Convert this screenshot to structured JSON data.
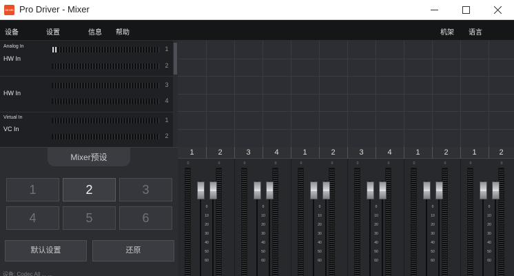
{
  "window": {
    "title": "Pro Driver - Mixer",
    "logo_text": "BEHRI"
  },
  "menu": {
    "left": [
      "设备",
      "设置",
      "信息",
      "帮助"
    ],
    "right": [
      "机架",
      "语言"
    ]
  },
  "inputs": {
    "groups": [
      {
        "small": "Analog In",
        "name": "HW In",
        "channels": [
          "1",
          "2"
        ]
      },
      {
        "small": "",
        "name": "HW In",
        "channels": [
          "3",
          "4"
        ]
      },
      {
        "small": "Virtual In",
        "name": "VC In",
        "channels": [
          "1",
          "2"
        ]
      }
    ]
  },
  "preset": {
    "title": "Mixer预设",
    "buttons": [
      "1",
      "2",
      "3",
      "4",
      "5",
      "6"
    ],
    "selected": "2",
    "default_label": "默认设置",
    "restore_label": "还原",
    "status": "设备: Codec All ... ..."
  },
  "outputs": {
    "channels": [
      "1",
      "2",
      "3",
      "4",
      "1",
      "2",
      "3",
      "4",
      "1",
      "2",
      "1",
      "2"
    ],
    "scale_top": "0",
    "fader_scale": [
      "0",
      "10",
      "20",
      "30",
      "40",
      "50",
      "60"
    ]
  },
  "icons": {
    "minimize": "minimize-icon",
    "maximize": "maximize-icon",
    "close": "close-icon"
  }
}
